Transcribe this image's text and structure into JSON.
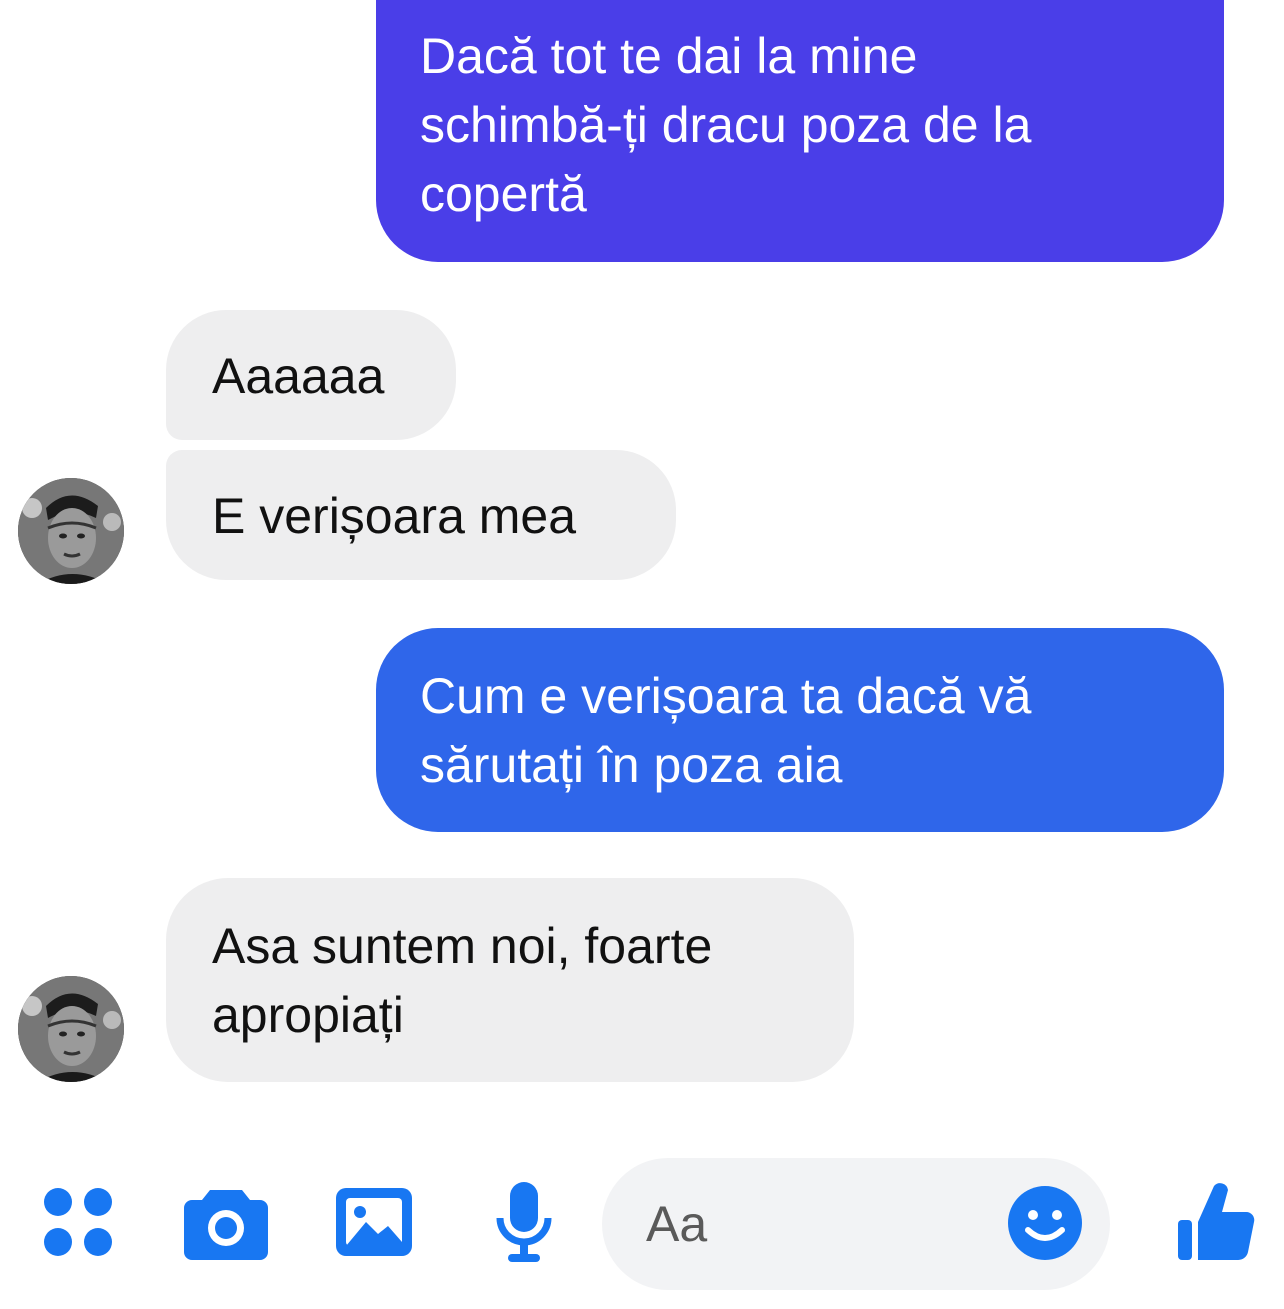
{
  "colors": {
    "sent_bubble_1": "#4a3ee8",
    "sent_bubble_2": "#2f66ea",
    "received_bubble": "#eeeeef",
    "icon_blue": "#1877f2"
  },
  "messages": [
    {
      "direction": "sent",
      "text": "Dacă tot te dai la mine\nschimbă-ți dracu poza de la\ncopertă"
    },
    {
      "direction": "received",
      "text": "Aaaaaa"
    },
    {
      "direction": "received",
      "text": "E verișoara mea"
    },
    {
      "direction": "sent",
      "text": "Cum e verișoara  ta dacă vă\nsărutați în poza aia"
    },
    {
      "direction": "received",
      "text": "Asa suntem noi, foarte\napropiați"
    }
  ],
  "composer": {
    "placeholder": "Aa",
    "icons": [
      "apps-icon",
      "camera-icon",
      "gallery-icon",
      "microphone-icon",
      "emoji-icon",
      "like-icon"
    ]
  }
}
